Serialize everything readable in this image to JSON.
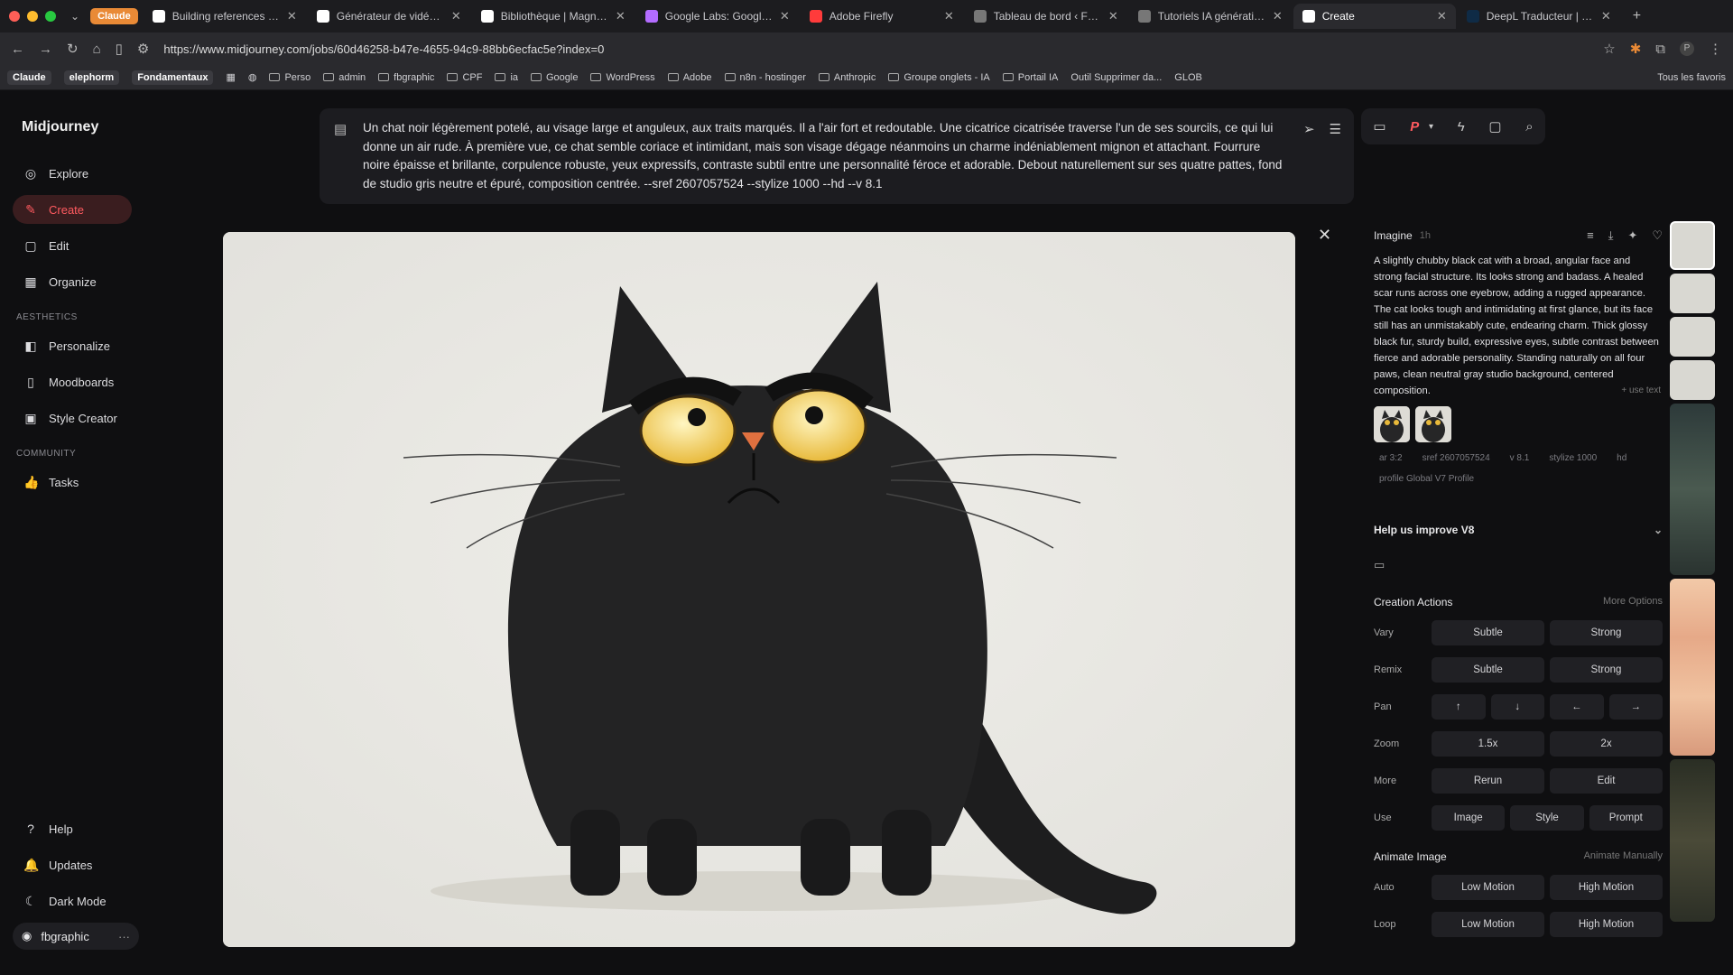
{
  "browser": {
    "pinned": "Claude",
    "tabs": [
      {
        "label": "Building references and g",
        "color": "#ffffff",
        "active": false
      },
      {
        "label": "Générateur de vidéos I M",
        "color": "#ffffff",
        "active": false
      },
      {
        "label": "Bibliothèque | Magnific IA",
        "color": "#ffffff",
        "active": false
      },
      {
        "label": "Google Labs: Google's fo",
        "color": "#b36cff",
        "active": false
      },
      {
        "label": "Adobe Firefly",
        "color": "#ff3b3b",
        "active": false
      },
      {
        "label": "Tableau de bord ‹ Format",
        "color": "#777777",
        "active": false
      },
      {
        "label": "Tutoriels IA générative &",
        "color": "#777777",
        "active": false
      },
      {
        "label": "Create",
        "color": "#ffffff",
        "active": true
      },
      {
        "label": "DeepL Traducteur | Le m",
        "color": "#0f2b46",
        "active": false
      }
    ],
    "url": "https://www.midjourney.com/jobs/60d46258-b47e-4655-94c9-88bb6ecfac5e?index=0",
    "bookmarks": {
      "chips": [
        "Claude",
        "elephorm",
        "Fondamentaux"
      ],
      "folders": [
        "Perso",
        "admin",
        "fbgraphic",
        "CPF",
        "ia",
        "Google",
        "WordPress",
        "Adobe",
        "n8n - hostinger",
        "Anthropic",
        "Groupe onglets - IA",
        "Portail IA"
      ],
      "extra": [
        "Outil Supprimer da...",
        "GLOB"
      ],
      "all": "Tous les favoris"
    }
  },
  "sidebar": {
    "brand": "Midjourney",
    "items": [
      {
        "label": "Explore",
        "icon": "◎"
      },
      {
        "label": "Create",
        "icon": "✎"
      },
      {
        "label": "Edit",
        "icon": "▢"
      },
      {
        "label": "Organize",
        "icon": "▦"
      }
    ],
    "aesthetics_label": "AESTHETICS",
    "aesthetics": [
      {
        "label": "Personalize",
        "icon": "◧"
      },
      {
        "label": "Moodboards",
        "icon": "▯"
      },
      {
        "label": "Style Creator",
        "icon": "▣"
      }
    ],
    "community_label": "COMMUNITY",
    "community": [
      {
        "label": "Tasks",
        "icon": "👍"
      }
    ],
    "bottom": [
      {
        "label": "Help",
        "icon": "?"
      },
      {
        "label": "Updates",
        "icon": "🔔"
      },
      {
        "label": "Dark Mode",
        "icon": "☾"
      }
    ],
    "user": "fbgraphic",
    "user_more": "···"
  },
  "prompt": {
    "text": "Un chat noir légèrement potelé, au visage large et anguleux, aux traits marqués. Il a l'air fort et redoutable. Une cicatrice cicatrisée traverse l'un de ses sourcils, ce qui lui donne un air rude. À première vue, ce chat semble coriace et intimidant, mais son visage dégage néanmoins un charme indéniablement mignon et attachant. Fourrure noire épaisse et brillante, corpulence robuste, yeux expressifs, contraste subtil entre une personnalité féroce et adorable. Debout naturellement sur ses quatre pattes, fond de studio gris neutre et épuré, composition centrée. --sref 2607057524 --stylize 1000 --hd --v 8.1"
  },
  "topicons": {
    "profile": "P"
  },
  "panel": {
    "mode": "Imagine",
    "ago": "1h",
    "description": "A slightly chubby black cat with a broad, angular face and strong facial structure. Its looks strong and badass. A healed scar runs across one eyebrow, adding a rugged appearance. The cat looks tough and intimidating at first glance, but its face still has an unmistakably cute, endearing charm. Thick glossy black fur, sturdy build, expressive eyes, subtle contrast between fierce and adorable personality. Standing naturally on all four paws, clean neutral gray studio background, centered composition.",
    "use_text": "+ use text",
    "params": [
      "ar 3:2",
      "sref 2607057524",
      "v 8.1",
      "stylize 1000",
      "hd",
      "profile Global V7 Profile"
    ],
    "help": "Help us improve V8",
    "creation_actions": "Creation Actions",
    "more_options": "More Options",
    "rows": [
      {
        "label": "Vary",
        "buttons": [
          "Subtle",
          "Strong"
        ]
      },
      {
        "label": "Remix",
        "buttons": [
          "Subtle",
          "Strong"
        ]
      },
      {
        "label": "Pan",
        "buttons": [
          "↑",
          "↓",
          "←",
          "→"
        ]
      },
      {
        "label": "Zoom",
        "buttons": [
          "1.5x",
          "2x"
        ]
      },
      {
        "label": "More",
        "buttons": [
          "Rerun",
          "Edit"
        ]
      },
      {
        "label": "Use",
        "buttons": [
          "Image",
          "Style",
          "Prompt"
        ]
      }
    ],
    "animate_image": "Animate Image",
    "animate_manually": "Animate Manually",
    "anim_rows": [
      {
        "label": "Auto",
        "buttons": [
          "Low Motion",
          "High Motion"
        ]
      },
      {
        "label": "Loop",
        "buttons": [
          "Low Motion",
          "High Motion"
        ]
      }
    ]
  },
  "colors": {
    "accent": "#ff5a5f",
    "bg": "#0f0f11"
  }
}
